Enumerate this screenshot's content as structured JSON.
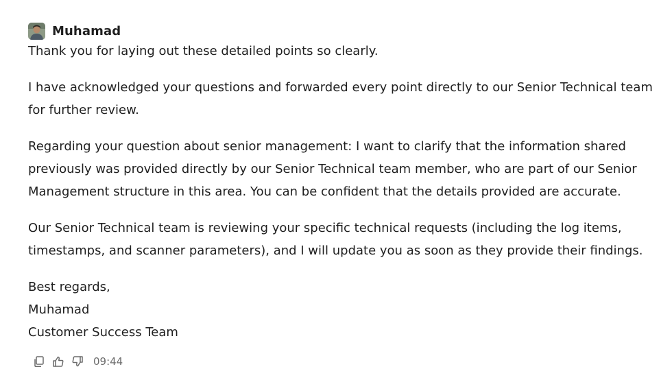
{
  "message": {
    "sender": "Muhamad",
    "paragraphs": [
      "Thank you for laying out these detailed points so clearly.",
      "I have acknowledged your questions and forwarded every point directly to our Senior Technical team for further review.",
      "Regarding your question about senior management: I want to clarify that the information shared previously was provided directly by our Senior Technical team member, who are part of our Senior Management structure in this area. You can be confident that the details provided are accurate.",
      "Our Senior Technical team is reviewing your specific technical requests (including the log items, timestamps, and scanner parameters), and I will update you as soon as they provide their findings."
    ],
    "signature": {
      "closing": "Best regards,",
      "name": "Muhamad",
      "team": "Customer Success Team"
    },
    "time": "09:44"
  },
  "icons": {
    "copy": "copy-icon",
    "like": "thumbs-up-icon",
    "dislike": "thumbs-down-icon"
  },
  "colors": {
    "text": "#1f1f1f",
    "muted": "#6b6b6b",
    "background": "#ffffff"
  }
}
